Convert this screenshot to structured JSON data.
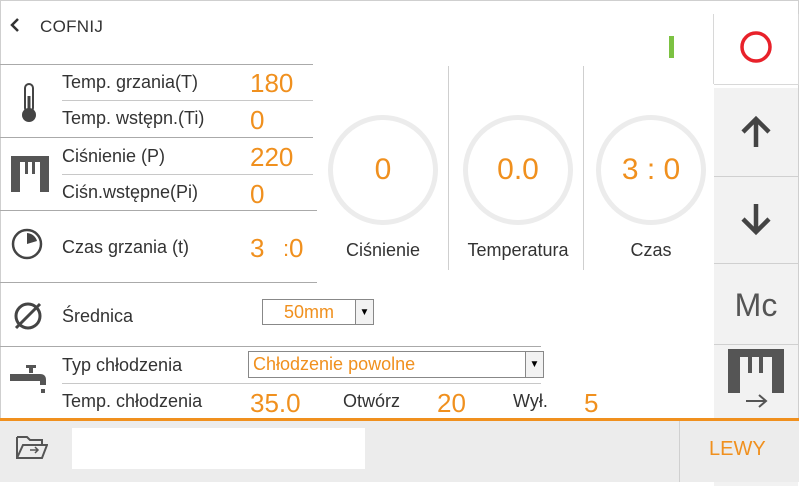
{
  "nav": {
    "back_label": "COFNIJ"
  },
  "params": {
    "temp_heat": {
      "label": "Temp. grzania(T)",
      "value": "180"
    },
    "temp_pre": {
      "label": "Temp. wstępn.(Ti)",
      "value": "0"
    },
    "pressure": {
      "label": "Ciśnienie (P)",
      "value": "220"
    },
    "pressure_pre": {
      "label": "Ciśn.wstępne(Pi)",
      "value": "0"
    },
    "heat_time": {
      "label": "Czas grzania (t)",
      "minutes": "3",
      "sep": ":",
      "seconds": "0"
    },
    "diameter": {
      "label": "Średnica",
      "value": "50mm"
    },
    "cooling_type": {
      "label": "Typ chłodzenia",
      "value": "Chłodzenie powolne"
    },
    "cooling_temp": {
      "label": "Temp. chłodzenia",
      "value": "35.0"
    },
    "opening": {
      "label": "Otwórz",
      "value": "20"
    },
    "off": {
      "label": "Wył.",
      "value": "5"
    }
  },
  "gauges": [
    {
      "value": "0",
      "label": "Ciśnienie"
    },
    {
      "value": "0.0",
      "label": "Temperatura"
    },
    {
      "value": "3 : 0",
      "label": "Czas"
    }
  ],
  "side": {
    "mc_label": "Mc"
  },
  "footer": {
    "input_value": "",
    "side_label": "LEWY"
  },
  "colors": {
    "accent": "#f0901e",
    "stop": "#e8212a",
    "status": "#7cc242"
  }
}
